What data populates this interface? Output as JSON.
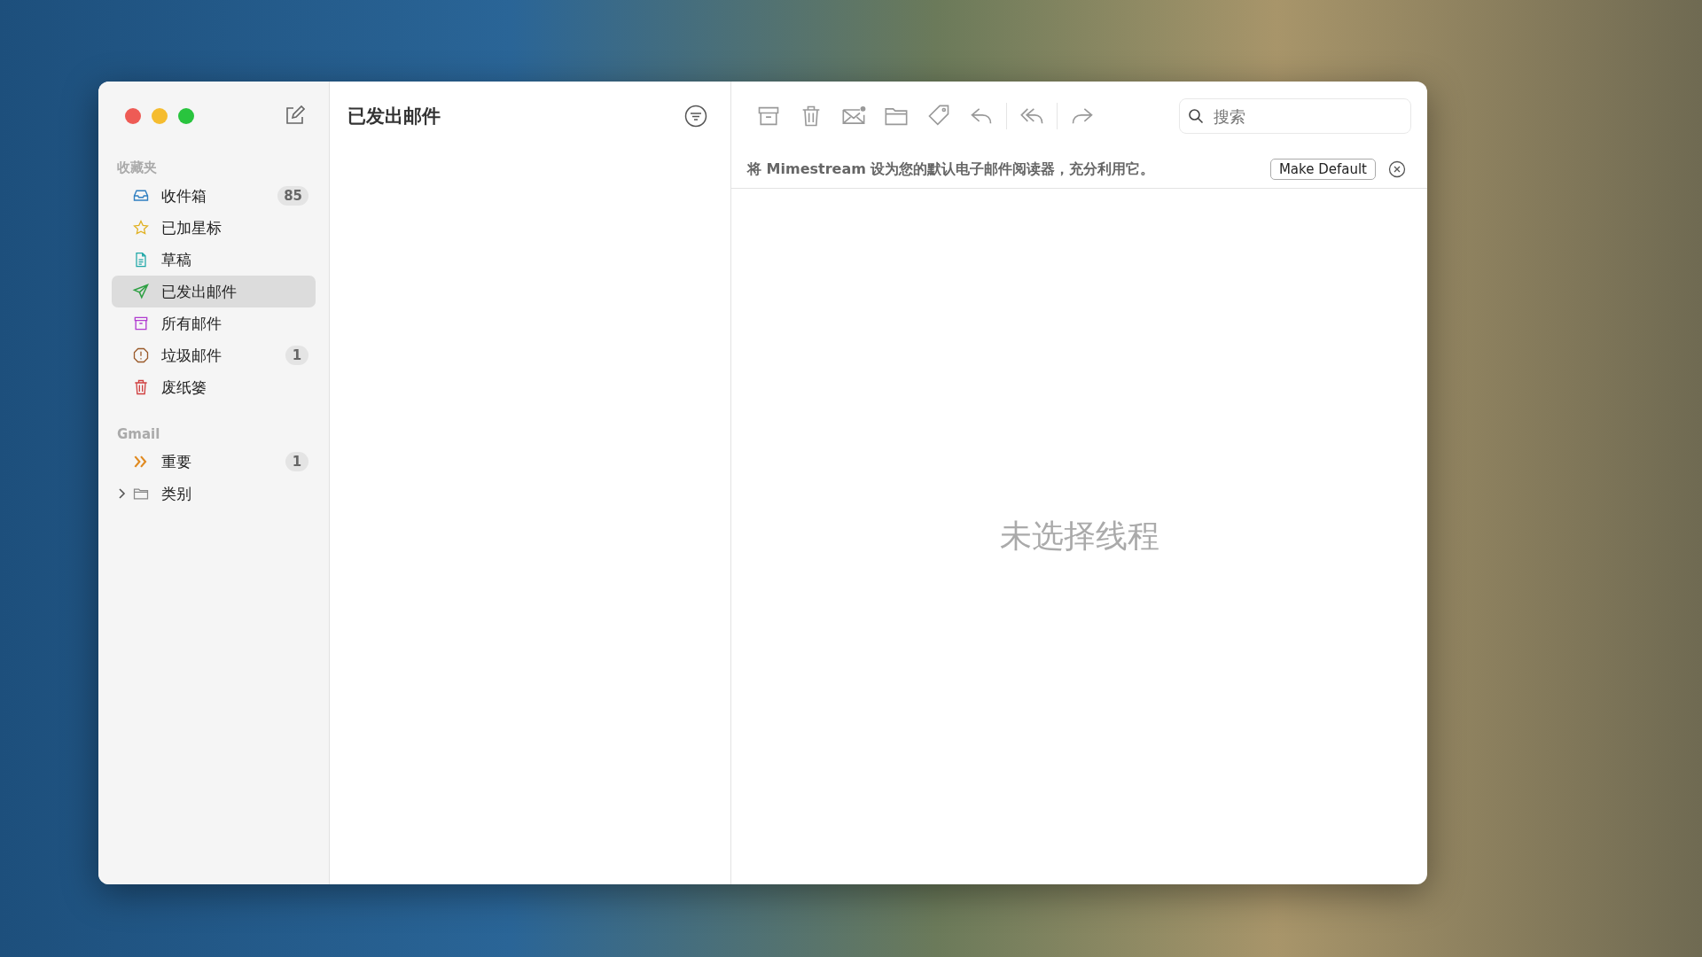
{
  "window": {
    "title": "已发出邮件"
  },
  "sidebar": {
    "sections": [
      {
        "heading": "收藏夹",
        "items": [
          {
            "kind": "inbox",
            "label": "收件箱",
            "badge": "85",
            "color": "#2f7fc1",
            "selected": false
          },
          {
            "kind": "star",
            "label": "已加星标",
            "color": "#e0b020",
            "selected": false
          },
          {
            "kind": "draft",
            "label": "草稿",
            "color": "#1fa7a7",
            "selected": false
          },
          {
            "kind": "sent",
            "label": "已发出邮件",
            "color": "#2ea043",
            "selected": true
          },
          {
            "kind": "archive",
            "label": "所有邮件",
            "color": "#b03bd0",
            "selected": false
          },
          {
            "kind": "spam",
            "label": "垃圾邮件",
            "badge": "1",
            "color": "#9a5a2a",
            "selected": false
          },
          {
            "kind": "trash",
            "label": "废纸篓",
            "color": "#d04040",
            "selected": false
          }
        ]
      },
      {
        "heading": "Gmail",
        "items": [
          {
            "kind": "important",
            "label": "重要",
            "badge": "1",
            "color": "#e08a20",
            "selected": false
          },
          {
            "kind": "folder",
            "label": "类别",
            "color": "#888888",
            "selected": false,
            "expanded": false
          }
        ]
      }
    ]
  },
  "toolbar": {
    "tools": [
      {
        "kind": "archive"
      },
      {
        "kind": "trash"
      },
      {
        "kind": "unread"
      },
      {
        "kind": "move"
      },
      {
        "kind": "label"
      },
      {
        "kind": "reply"
      },
      {
        "kind": "reply-all"
      },
      {
        "kind": "forward"
      }
    ],
    "search": {
      "placeholder": "搜索"
    }
  },
  "banner": {
    "text": "将 Mimestream 设为您的默认电子邮件阅读器，充分利用它。",
    "button": "Make Default"
  },
  "detail": {
    "empty_text": "未选择线程"
  }
}
